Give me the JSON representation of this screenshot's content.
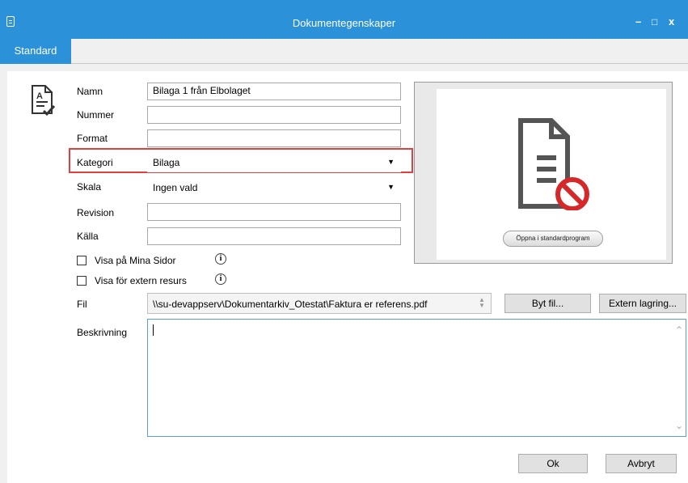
{
  "window": {
    "title": "Dokumentegenskaper",
    "minimize_label": "–",
    "maximize_label": "□",
    "close_label": "x"
  },
  "tabs": [
    {
      "label": "Standard",
      "active": true
    }
  ],
  "form": {
    "name_label": "Namn",
    "name_value": "Bilaga 1 från Elbolaget",
    "number_label": "Nummer",
    "number_value": "",
    "format_label": "Format",
    "format_value": "",
    "category_label": "Kategori",
    "category_value": "Bilaga",
    "scale_label": "Skala",
    "scale_value": "Ingen vald",
    "revision_label": "Revision",
    "revision_value": "",
    "source_label": "Källa",
    "source_value": "",
    "show_on_my_pages_label": "Visa på Mina Sidor",
    "show_on_my_pages_checked": false,
    "show_for_external_label": "Visa för extern resurs",
    "show_for_external_checked": false,
    "file_label": "Fil",
    "file_value": "\\\\su-devappserv\\Dokumentarkiv_Otestat\\Faktura er referens.pdf",
    "change_file_label": "Byt fil...",
    "external_storage_label": "Extern lagring...",
    "description_label": "Beskrivning",
    "description_value": ""
  },
  "preview": {
    "open_button_label": "Öppna i standardprogram"
  },
  "footer": {
    "ok_label": "Ok",
    "cancel_label": "Avbryt"
  },
  "colors": {
    "accent": "#2b91d9",
    "highlight": "#e04040"
  }
}
